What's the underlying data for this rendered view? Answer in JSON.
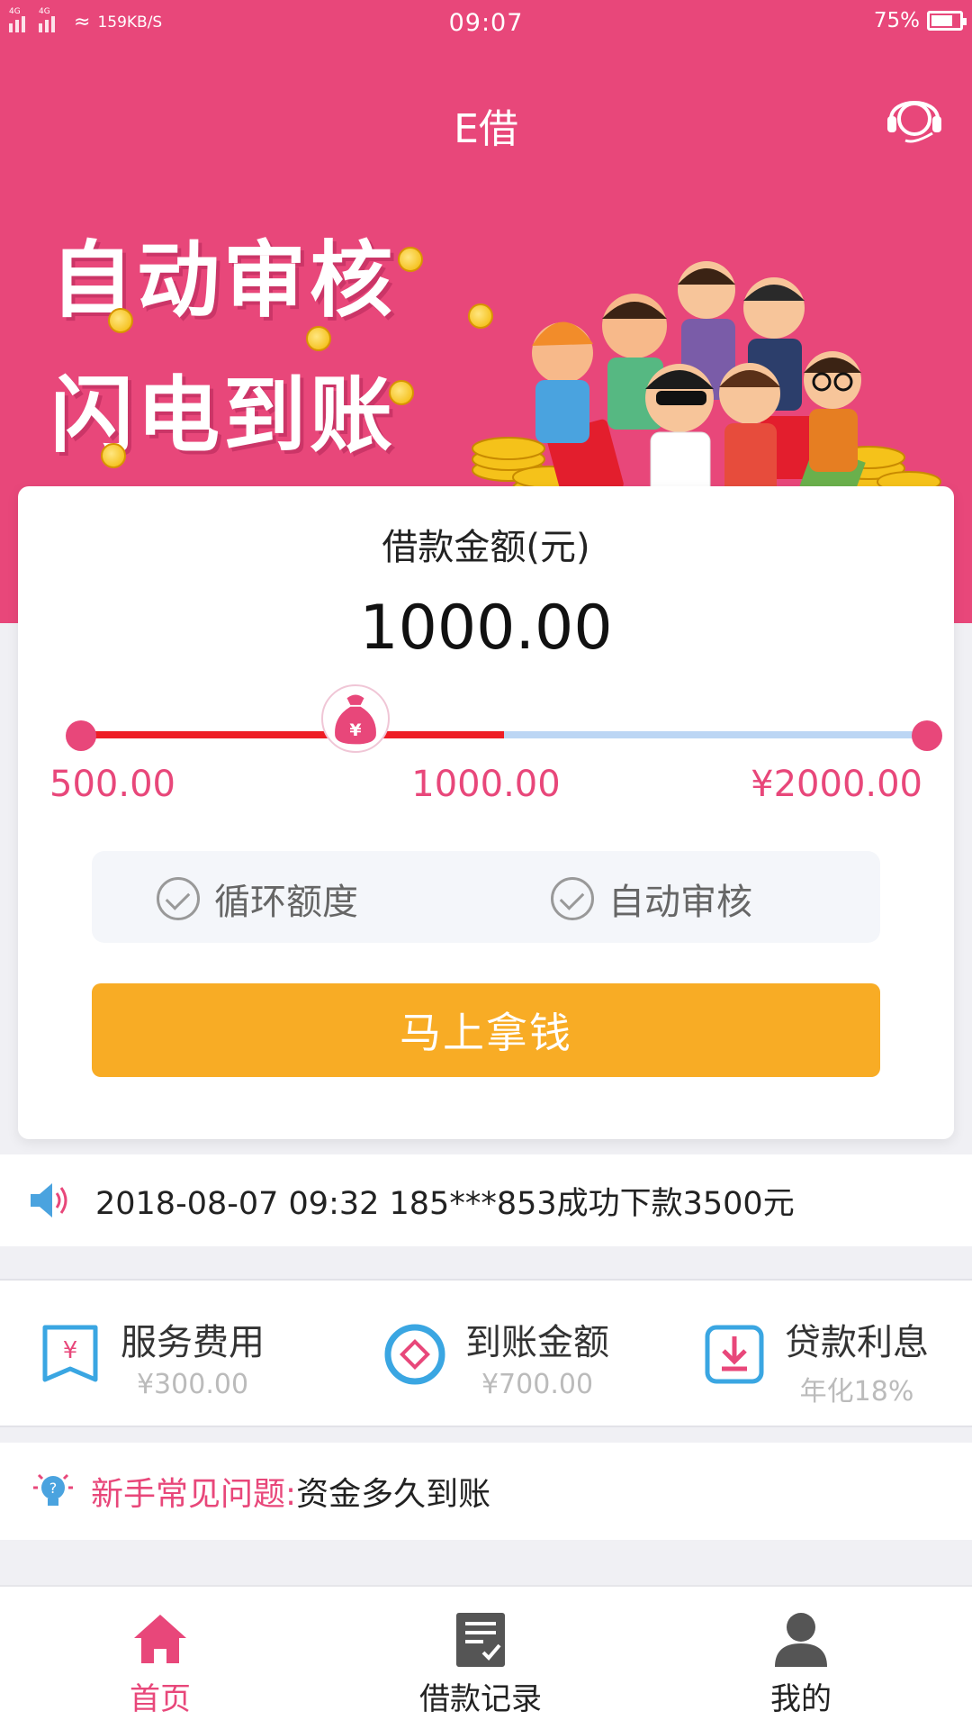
{
  "status_bar": {
    "network_type": "4G",
    "network_type_2": "4G",
    "speed": "159KB/S",
    "time": "09:07",
    "battery_percent": "75%",
    "battery_level": 0.75
  },
  "header": {
    "title": "E借",
    "customer_service_icon": "headset-icon"
  },
  "banner": {
    "line1": "自动审核",
    "line2": "闪电到账"
  },
  "loan": {
    "label": "借款金额(元)",
    "amount": "1000.00",
    "min_label": "500.00",
    "mid_label": "1000.00",
    "max_label": "¥2000.00",
    "slider_fraction": 0.5,
    "thumb_fraction": 0.33,
    "thumb_icon": "money-bag-icon",
    "features": [
      "循环额度",
      "自动审核"
    ],
    "cta_label": "马上拿钱"
  },
  "notice": {
    "icon": "speaker-icon",
    "text": "2018-08-07 09:32 185***853成功下款3500元"
  },
  "fees": [
    {
      "icon": "yuan-ticket-icon",
      "title": "服务费用",
      "value": "¥300.00"
    },
    {
      "icon": "diamond-circle-icon",
      "title": "到账金额",
      "value": "¥700.00"
    },
    {
      "icon": "download-box-icon",
      "title": "贷款利息",
      "value": "年化18%"
    }
  ],
  "faq": {
    "icon": "lightbulb-question-icon",
    "label": "新手常见问题:",
    "question": "资金多久到账"
  },
  "tabbar": [
    {
      "icon": "home-icon",
      "label": "首页",
      "active": true
    },
    {
      "icon": "records-icon",
      "label": "借款记录",
      "active": false
    },
    {
      "icon": "user-icon",
      "label": "我的",
      "active": false
    }
  ],
  "colors": {
    "brand_pink": "#e8477a",
    "cta_orange": "#f8ac25",
    "slider_red": "#ee1d25",
    "slider_blue": "#bcd6f4"
  }
}
